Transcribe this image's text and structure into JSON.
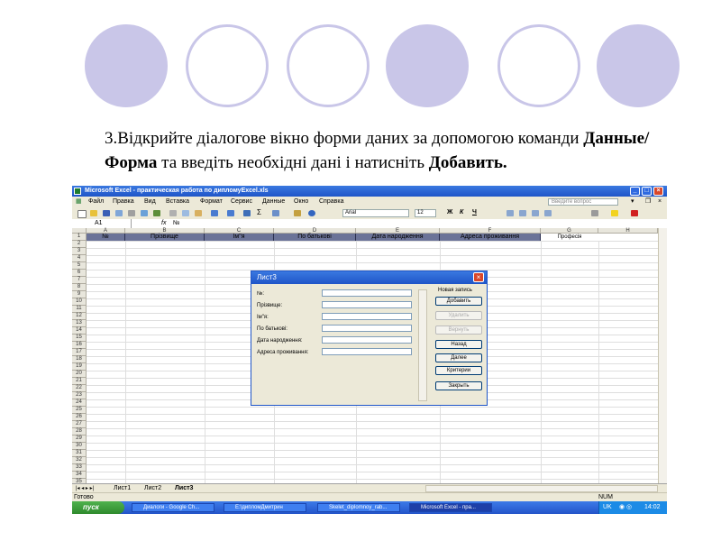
{
  "slide": {
    "circles": [
      {
        "style": "filled"
      },
      {
        "style": "outline"
      },
      {
        "style": "outline"
      },
      {
        "style": "filled"
      },
      {
        "style": "outline"
      },
      {
        "style": "filled"
      }
    ],
    "instruction_prefix": "3.Відкрийте діалогове вікно форми даних за допомогою команди ",
    "instruction_bold1": "Данные/Форма",
    "instruction_mid": " та введіть необхідні дані і натисніть ",
    "instruction_bold2": "Добавить."
  },
  "excel": {
    "title": "Microsoft Excel - практическая работа по дипломуExcel.xls",
    "menu": [
      "Файл",
      "Правка",
      "Вид",
      "Вставка",
      "Формат",
      "Сервис",
      "Данные",
      "Окно",
      "Справка"
    ],
    "help_placeholder": "Введите вопрос",
    "font_name": "Arial",
    "font_size": "12",
    "format_buttons": [
      "Ж",
      "К",
      "Ч"
    ],
    "name_box": "A1",
    "formula_value": "№",
    "columns": [
      "A",
      "B",
      "C",
      "D",
      "E",
      "F",
      "G",
      "H"
    ],
    "header_row": [
      "№",
      "Прізвище",
      "Ім\"я",
      "По батькові",
      "Дата народження",
      "Адреса проживання",
      "Професія"
    ],
    "rows": [
      "1",
      "2",
      "3",
      "4",
      "5",
      "6",
      "7",
      "8",
      "9",
      "10",
      "11",
      "12",
      "13",
      "14",
      "15",
      "16",
      "17",
      "18",
      "19",
      "20",
      "21",
      "22",
      "23",
      "24",
      "25",
      "26",
      "27",
      "28",
      "29",
      "30",
      "31",
      "32",
      "33",
      "34",
      "35"
    ],
    "sheets": [
      "Лист1",
      "Лист2",
      "Лист3"
    ],
    "active_sheet": "Лист3",
    "status_left": "Готово",
    "status_right": "NUM"
  },
  "dialog": {
    "title": "Лист3",
    "fields": [
      {
        "label": "№:",
        "value": ""
      },
      {
        "label": "Прізвище:",
        "value": ""
      },
      {
        "label": "Ім\"я:",
        "value": ""
      },
      {
        "label": "По батькові:",
        "value": ""
      },
      {
        "label": "Дата народження:",
        "value": ""
      },
      {
        "label": "Адреса проживання:",
        "value": ""
      }
    ],
    "new_record_label": "Новая запись",
    "buttons": [
      {
        "label": "Добавить",
        "enabled": true
      },
      {
        "label": "Удалить",
        "enabled": false
      },
      {
        "label": "Вернуть",
        "enabled": false
      },
      {
        "label": "Назад",
        "enabled": true
      },
      {
        "label": "Далее",
        "enabled": true
      },
      {
        "label": "Критерии",
        "enabled": true
      },
      {
        "label": "Закрыть",
        "enabled": true
      }
    ]
  },
  "taskbar": {
    "start_label": "пуск",
    "tasks": [
      {
        "label": "Диалоги - Google Ch...",
        "active": false
      },
      {
        "label": "E:\\дипломДмитрин",
        "active": false
      },
      {
        "label": "Skelet_diplomnoy_rab...",
        "active": false
      },
      {
        "label": "Microsoft Excel - пра...",
        "active": true
      }
    ],
    "lang": "UK",
    "clock": "14:02"
  },
  "colors": {
    "circle": "#c9c6e8",
    "header_fill": "#6b7398",
    "title_blue": "#1f55c8",
    "start_green": "#3a9a38"
  }
}
